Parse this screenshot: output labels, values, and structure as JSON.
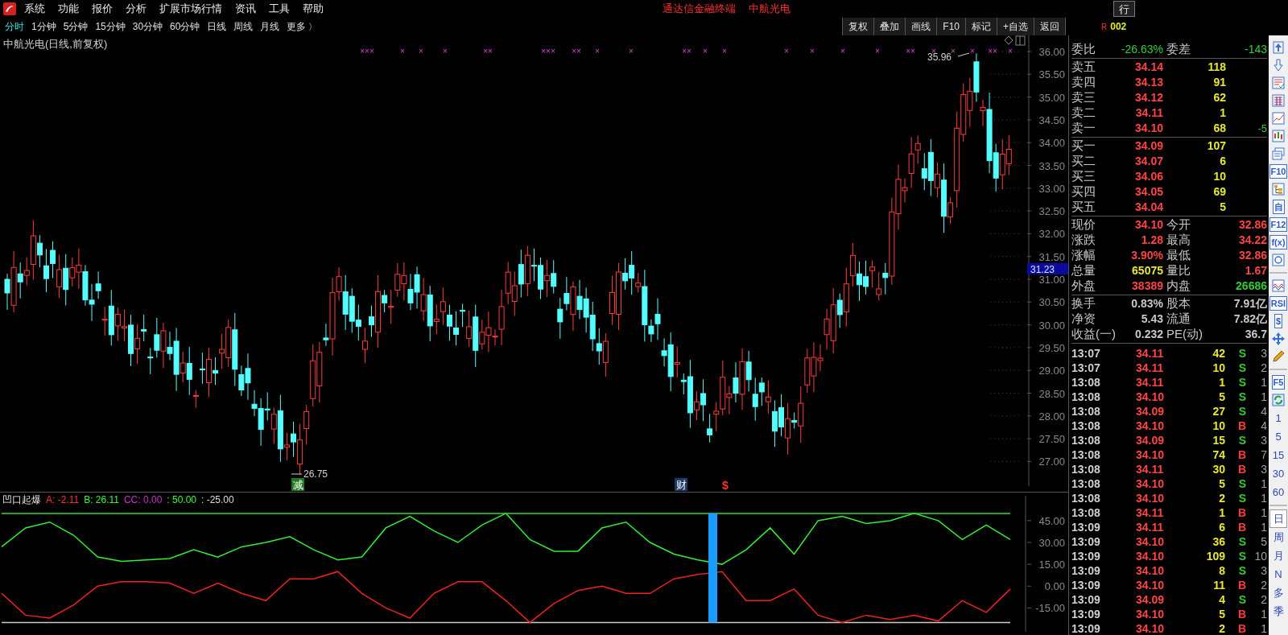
{
  "menu": {
    "items": [
      "系统",
      "功能",
      "报价",
      "分析",
      "扩展市场行情",
      "资讯",
      "工具",
      "帮助"
    ],
    "title": "通达信金融终端",
    "stock": "中航光电",
    "right_button": "行"
  },
  "periods": [
    {
      "label": "分时",
      "selected": true
    },
    {
      "label": "1分钟",
      "selected": false
    },
    {
      "label": "5分钟",
      "selected": false
    },
    {
      "label": "15分钟",
      "selected": false
    },
    {
      "label": "30分钟",
      "selected": false
    },
    {
      "label": "60分钟",
      "selected": false
    },
    {
      "label": "日线",
      "selected": false
    },
    {
      "label": "周线",
      "selected": false
    },
    {
      "label": "月线",
      "selected": false
    },
    {
      "label": "更多",
      "selected": false
    }
  ],
  "more_arrow": "〉",
  "toolbar": [
    "复权",
    "叠加",
    "画线",
    "F10",
    "标记",
    "+自选",
    "返回"
  ],
  "badge": "R",
  "code": "002",
  "chart": {
    "title": "中航光电(日线,前复权)",
    "yticks": [
      "36.00",
      "35.50",
      "35.00",
      "34.50",
      "34.00",
      "33.50",
      "33.00",
      "32.50",
      "32.00",
      "31.50",
      "31.00",
      "30.50",
      "30.00",
      "29.50",
      "29.00",
      "28.50",
      "28.00",
      "27.50",
      "27.00"
    ],
    "price_tag": "31.23",
    "high_label": "35.96",
    "low_label": "26.75",
    "x_marks": [
      "×××",
      "×",
      "×",
      "×",
      "××",
      "×××",
      "××",
      "×",
      "×",
      "××",
      "×",
      "×",
      "×",
      "×",
      "×",
      "×",
      "××",
      "×",
      "×",
      "×",
      "××",
      "×"
    ],
    "event_marks": [
      {
        "text": "减",
        "kind": "boxed",
        "color": "#1e7a1e"
      },
      {
        "text": "财",
        "kind": "boxed",
        "color": "#1c3a66"
      },
      {
        "text": "$",
        "kind": "plain",
        "color": "#ff3333"
      }
    ]
  },
  "indicator": {
    "name": "凹口起爆",
    "params": [
      {
        "text": "A: -2.11",
        "color": "#ff3333"
      },
      {
        "text": "B: 26.11",
        "color": "#33ff33"
      },
      {
        "text": "CC: 0.00",
        "color": "#cc33cc"
      },
      {
        "text": ": 50.00",
        "color": "#33ff33"
      },
      {
        "text": ": -25.00",
        "color": "#dddddd"
      }
    ],
    "chart_data": {
      "type": "line",
      "ylim": [
        -31.4,
        62.1
      ],
      "yticks": [
        {
          "value": 45,
          "label": "45.00"
        },
        {
          "value": 30,
          "label": "30.00"
        },
        {
          "value": 15,
          "label": "15.00"
        },
        {
          "value": 0,
          "label": "0.00"
        },
        {
          "value": -15,
          "label": "-15.00"
        }
      ],
      "series": [
        {
          "color": "#33ee33",
          "values": [
            27,
            40,
            44,
            35,
            20,
            17,
            18,
            19,
            25,
            20,
            27,
            30,
            34,
            25,
            18,
            20,
            40,
            48,
            38,
            30,
            42,
            50,
            32,
            24,
            24,
            40,
            44,
            30,
            22,
            18,
            15,
            25,
            40,
            22,
            45,
            48,
            43,
            45,
            50,
            45,
            32,
            42,
            32
          ]
        },
        {
          "color": "#33dd33",
          "values": [
            50,
            50,
            50,
            50,
            50,
            50,
            50,
            50,
            50,
            50,
            50,
            50,
            50,
            50,
            50,
            50,
            50,
            50,
            50,
            50,
            50,
            50,
            50,
            50,
            50,
            50,
            50,
            50,
            50,
            50,
            50,
            50,
            50,
            50,
            50,
            50,
            50,
            50,
            50,
            50,
            50,
            50,
            50
          ]
        },
        {
          "color": "#cccccc",
          "values": [
            -25,
            -25,
            -25,
            -25,
            -25,
            -25,
            -25,
            -25,
            -25,
            -25,
            -25,
            -25,
            -25,
            -25,
            -25,
            -25,
            -25,
            -25,
            -25,
            -25,
            -25,
            -25,
            -25,
            -25,
            -25,
            -25,
            -25,
            -25,
            -25,
            -25,
            -25,
            -25,
            -25,
            -25,
            -25,
            -25,
            -25,
            -25,
            -25,
            -25,
            -25,
            -25,
            -25
          ]
        },
        {
          "color": "#ee2222",
          "values": [
            -5,
            -20,
            -22,
            -13,
            0,
            3,
            3,
            2,
            -5,
            2,
            -5,
            -10,
            5,
            5,
            10,
            -5,
            -15,
            -22,
            -5,
            3,
            3,
            -10,
            -25,
            -12,
            -3,
            0,
            -5,
            -5,
            5,
            8,
            10,
            -10,
            -10,
            -2,
            -20,
            -25,
            -20,
            -23,
            -20,
            -24,
            -10,
            -18,
            -2
          ]
        }
      ]
    }
  },
  "quote": {
    "ratio": {
      "label": "委比",
      "value": "-26.63%",
      "label2": "委差",
      "value2": "-143"
    },
    "asks": [
      {
        "label": "卖五",
        "price": "34.14",
        "volume": "118"
      },
      {
        "label": "卖四",
        "price": "34.13",
        "volume": "91"
      },
      {
        "label": "卖三",
        "price": "34.12",
        "volume": "62"
      },
      {
        "label": "卖二",
        "price": "34.11",
        "volume": "1"
      },
      {
        "label": "卖一",
        "price": "34.10",
        "volume": "68",
        "change": "-5"
      }
    ],
    "bids": [
      {
        "label": "买一",
        "price": "34.09",
        "volume": "107"
      },
      {
        "label": "买二",
        "price": "34.07",
        "volume": "6"
      },
      {
        "label": "买三",
        "price": "34.06",
        "volume": "10"
      },
      {
        "label": "买四",
        "price": "34.05",
        "volume": "69"
      },
      {
        "label": "买五",
        "price": "34.04",
        "volume": "5"
      }
    ],
    "stats": [
      {
        "left": {
          "label": "现价",
          "value": "34.10",
          "color": "#ff4444"
        },
        "right": {
          "label": "今开",
          "value": "32.86",
          "color": "#ff4444"
        }
      },
      {
        "left": {
          "label": "涨跌",
          "value": "1.28",
          "color": "#ff4444"
        },
        "right": {
          "label": "最高",
          "value": "34.22",
          "color": "#ff4444"
        }
      },
      {
        "left": {
          "label": "涨幅",
          "value": "3.90%",
          "color": "#ff4444"
        },
        "right": {
          "label": "最低",
          "value": "32.86",
          "color": "#ff4444"
        }
      },
      {
        "left": {
          "label": "总量",
          "value": "65075",
          "color": "#e6e633"
        },
        "right": {
          "label": "量比",
          "value": "1.67",
          "color": "#ff4444"
        }
      },
      {
        "left": {
          "label": "外盘",
          "value": "38389",
          "color": "#ff4444"
        },
        "right": {
          "label": "内盘",
          "value": "26686",
          "color": "#33cc33"
        }
      }
    ],
    "fundamentals": [
      {
        "label": "换手",
        "value": "0.83%",
        "label2": "股本",
        "value2": "7.91亿"
      },
      {
        "label": "净资",
        "value": "5.43",
        "label2": "流通",
        "value2": "7.82亿"
      },
      {
        "label": "收益(一)",
        "value": "0.232",
        "label2": "PE(动)",
        "value2": "36.7"
      }
    ]
  },
  "trades": [
    {
      "time": "13:07",
      "price": "34.11",
      "volume": "42",
      "side": "S",
      "kind": "sell",
      "count": "3"
    },
    {
      "time": "13:07",
      "price": "34.11",
      "volume": "10",
      "side": "S",
      "kind": "sell",
      "count": "2"
    },
    {
      "time": "13:08",
      "price": "34.11",
      "volume": "1",
      "side": "S",
      "kind": "sell",
      "count": "1"
    },
    {
      "time": "13:08",
      "price": "34.10",
      "volume": "5",
      "side": "S",
      "kind": "sell",
      "count": "1"
    },
    {
      "time": "13:08",
      "price": "34.09",
      "volume": "27",
      "side": "S",
      "kind": "sell",
      "count": "4"
    },
    {
      "time": "13:08",
      "price": "34.10",
      "volume": "10",
      "side": "B",
      "kind": "buy",
      "count": "4"
    },
    {
      "time": "13:08",
      "price": "34.09",
      "volume": "15",
      "side": "S",
      "kind": "sell",
      "count": "3"
    },
    {
      "time": "13:08",
      "price": "34.10",
      "volume": "74",
      "side": "B",
      "kind": "buy",
      "count": "7"
    },
    {
      "time": "13:08",
      "price": "34.11",
      "volume": "30",
      "side": "B",
      "kind": "buy",
      "count": "3"
    },
    {
      "time": "13:08",
      "price": "34.10",
      "volume": "5",
      "side": "S",
      "kind": "sell",
      "count": "1"
    },
    {
      "time": "13:08",
      "price": "34.10",
      "volume": "2",
      "side": "S",
      "kind": "sell",
      "count": "1"
    },
    {
      "time": "13:08",
      "price": "34.11",
      "volume": "1",
      "side": "B",
      "kind": "buy",
      "count": "1"
    },
    {
      "time": "13:09",
      "price": "34.11",
      "volume": "6",
      "side": "B",
      "kind": "buy",
      "count": "1"
    },
    {
      "time": "13:09",
      "price": "34.10",
      "volume": "36",
      "side": "S",
      "kind": "sell",
      "count": "5"
    },
    {
      "time": "13:09",
      "price": "34.10",
      "volume": "109",
      "side": "S",
      "kind": "sell",
      "count": "10"
    },
    {
      "time": "13:09",
      "price": "34.10",
      "volume": "8",
      "side": "S",
      "kind": "sell",
      "count": "3"
    },
    {
      "time": "13:09",
      "price": "34.10",
      "volume": "11",
      "side": "B",
      "kind": "buy",
      "count": "2"
    },
    {
      "time": "13:09",
      "price": "34.09",
      "volume": "4",
      "side": "S",
      "kind": "sell",
      "count": "2"
    },
    {
      "time": "13:09",
      "price": "34.10",
      "volume": "5",
      "side": "B",
      "kind": "buy",
      "count": "1"
    },
    {
      "time": "13:09",
      "price": "34.10",
      "volume": "2",
      "side": "B",
      "kind": "buy",
      "count": "1"
    }
  ],
  "tool_strip": [
    {
      "kind": "icon"
    },
    {
      "kind": "icon"
    },
    {
      "kind": "icon"
    },
    {
      "kind": "icon"
    },
    {
      "kind": "icon"
    },
    {
      "kind": "icon"
    },
    {
      "kind": "icon"
    },
    {
      "kind": "label",
      "label": "F10"
    },
    {
      "kind": "icon"
    },
    {
      "kind": "label",
      "label": "自"
    },
    {
      "kind": "label",
      "label": "F12"
    },
    {
      "kind": "label",
      "label": "f(x)"
    },
    {
      "kind": "icon"
    },
    {
      "kind": "divider"
    },
    {
      "kind": "icon"
    },
    {
      "kind": "label",
      "label": "RSI"
    },
    {
      "kind": "label",
      "label": "$"
    },
    {
      "kind": "icon"
    },
    {
      "kind": "icon"
    },
    {
      "kind": "divider"
    },
    {
      "kind": "label",
      "label": "F5"
    },
    {
      "kind": "icon"
    },
    {
      "kind": "period",
      "label": "1",
      "selected": false
    },
    {
      "kind": "period",
      "label": "5",
      "selected": false
    },
    {
      "kind": "period",
      "label": "15",
      "selected": false
    },
    {
      "kind": "period",
      "label": "30",
      "selected": false
    },
    {
      "kind": "period",
      "label": "60",
      "selected": false
    },
    {
      "kind": "divider"
    },
    {
      "kind": "period",
      "label": "日",
      "selected": true
    },
    {
      "kind": "period",
      "label": "周",
      "selected": false
    },
    {
      "kind": "period",
      "label": "月",
      "selected": false
    },
    {
      "kind": "period",
      "label": "N",
      "selected": false
    },
    {
      "kind": "period",
      "label": "多",
      "selected": false
    },
    {
      "kind": "period",
      "label": "季",
      "selected": false
    }
  ]
}
